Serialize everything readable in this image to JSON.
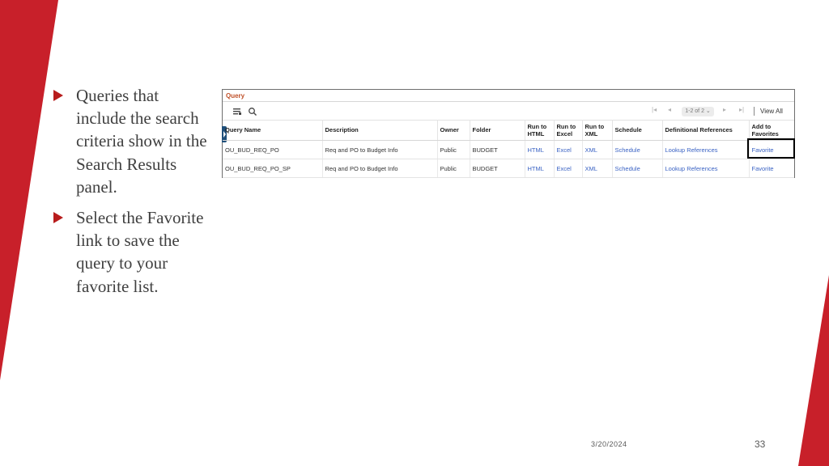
{
  "slide": {
    "bullets": [
      "Queries that include the search criteria show in the Search Results panel.",
      "Select the Favorite link to save the query to your favorite list."
    ],
    "date": "3/20/2024",
    "page_number": "33",
    "accent_color": "#c8202a"
  },
  "panel": {
    "title": "Query",
    "toolbar": {
      "range_label": "1-2 of 2",
      "view_all": "View All"
    },
    "columns": [
      "Query Name",
      "Description",
      "Owner",
      "Folder",
      "Run to HTML",
      "Run to Excel",
      "Run to XML",
      "Schedule",
      "Definitional References",
      "Add to Favorites"
    ],
    "rows": [
      {
        "name": "OU_BUD_REQ_PO",
        "description": "Req and PO to Budget Info",
        "owner": "Public",
        "folder": "BUDGET",
        "html": "HTML",
        "excel": "Excel",
        "xml": "XML",
        "schedule": "Schedule",
        "references": "Lookup References",
        "favorite": "Favorite"
      },
      {
        "name": "OU_BUD_REQ_PO_SP",
        "description": "Req and PO to Budget Info",
        "owner": "Public",
        "folder": "BUDGET",
        "html": "HTML",
        "excel": "Excel",
        "xml": "XML",
        "schedule": "Schedule",
        "references": "Lookup References",
        "favorite": "Favorite"
      }
    ]
  }
}
